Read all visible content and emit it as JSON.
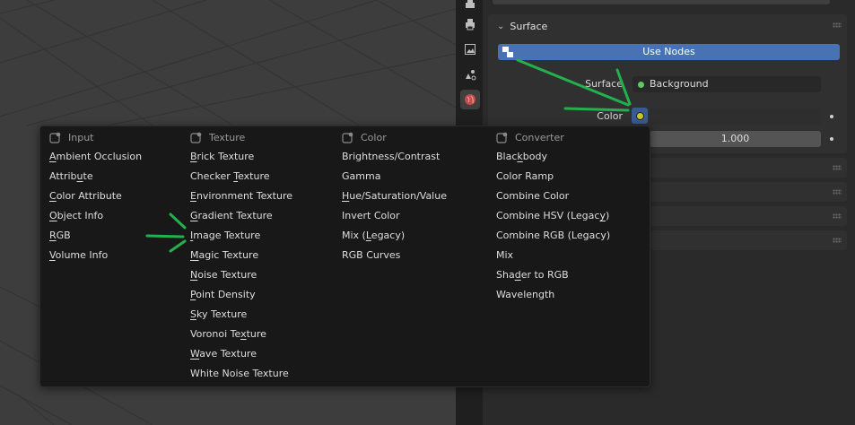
{
  "properties": {
    "surface_panel": {
      "title": "Surface",
      "use_nodes_label": "Use Nodes",
      "surface_label": "Surface",
      "surface_value": "Background",
      "color_label": "Color",
      "strength_value": "1.000"
    }
  },
  "menu": {
    "columns": [
      {
        "header": "Input",
        "items": [
          {
            "pre": "",
            "u": "A",
            "post": "mbient Occlusion"
          },
          {
            "pre": "Attrib",
            "u": "u",
            "post": "te"
          },
          {
            "pre": "",
            "u": "C",
            "post": "olor Attribute"
          },
          {
            "pre": "",
            "u": "O",
            "post": "bject Info"
          },
          {
            "pre": "",
            "u": "R",
            "post": "GB"
          },
          {
            "pre": "",
            "u": "V",
            "post": "olume Info"
          }
        ]
      },
      {
        "header": "Texture",
        "items": [
          {
            "pre": "",
            "u": "B",
            "post": "rick Texture"
          },
          {
            "pre": "Checker ",
            "u": "T",
            "post": "exture"
          },
          {
            "pre": "",
            "u": "E",
            "post": "nvironment Texture"
          },
          {
            "pre": "",
            "u": "G",
            "post": "radient Texture"
          },
          {
            "pre": "",
            "u": "I",
            "post": "mage Texture"
          },
          {
            "pre": "",
            "u": "M",
            "post": "agic Texture"
          },
          {
            "pre": "",
            "u": "N",
            "post": "oise Texture"
          },
          {
            "pre": "",
            "u": "P",
            "post": "oint Density"
          },
          {
            "pre": "",
            "u": "S",
            "post": "ky Texture"
          },
          {
            "pre": "Voronoi Te",
            "u": "x",
            "post": "ture"
          },
          {
            "pre": "",
            "u": "W",
            "post": "ave Texture"
          },
          {
            "pre": "White Noise Texture",
            "u": "",
            "post": ""
          }
        ]
      },
      {
        "header": "Color",
        "items": [
          {
            "pre": "Brightness/Contrast",
            "u": "",
            "post": ""
          },
          {
            "pre": "Gamma",
            "u": "",
            "post": ""
          },
          {
            "pre": "",
            "u": "H",
            "post": "ue/Saturation/Value"
          },
          {
            "pre": "Invert Color",
            "u": "",
            "post": ""
          },
          {
            "pre": "Mix (",
            "u": "L",
            "post": "egacy)"
          },
          {
            "pre": "RGB Curves",
            "u": "",
            "post": ""
          }
        ]
      },
      {
        "header": "Converter",
        "items": [
          {
            "pre": "Blac",
            "u": "k",
            "post": "body"
          },
          {
            "pre": "Color Ramp",
            "u": "",
            "post": ""
          },
          {
            "pre": "Combine Color",
            "u": "",
            "post": ""
          },
          {
            "pre": "Combine HSV (Legac",
            "u": "y",
            "post": ")"
          },
          {
            "pre": "Combine RGB (Legacy)",
            "u": "",
            "post": ""
          },
          {
            "pre": "Mix",
            "u": "",
            "post": ""
          },
          {
            "pre": "Sha",
            "u": "d",
            "post": "er to RGB"
          },
          {
            "pre": "Wavelength",
            "u": "",
            "post": ""
          }
        ]
      }
    ]
  },
  "colors": {
    "accent_blue": "#4772b3",
    "socket_green": "#63c763",
    "socket_yellow": "#c7c729",
    "annotation_green": "#22b14c"
  }
}
